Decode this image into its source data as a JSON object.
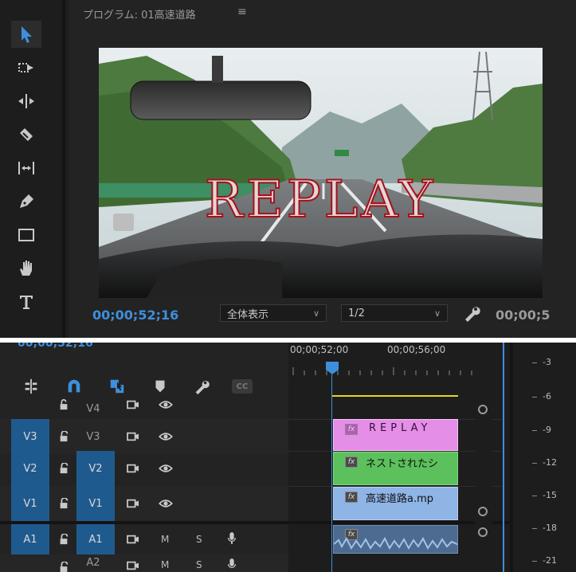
{
  "program_monitor": {
    "title": "プログラム: 01高速道路",
    "menu_icon": "≡",
    "timecode_current": "00;00;52;16",
    "timecode_duration": "00;00;5",
    "fit_dropdown": "全体表示",
    "resolution_dropdown": "1/2",
    "overlay_text": "REPLAY"
  },
  "tools": [
    {
      "name": "selection-tool-icon",
      "active": true
    },
    {
      "name": "track-select-forward-icon"
    },
    {
      "name": "ripple-edit-icon"
    },
    {
      "name": "razor-icon"
    },
    {
      "name": "slip-icon"
    },
    {
      "name": "pen-icon"
    },
    {
      "name": "rectangle-icon"
    },
    {
      "name": "hand-icon"
    },
    {
      "name": "type-icon"
    }
  ],
  "timeline": {
    "timecode": "00;00;52;16",
    "cc_label": "CC",
    "ruler": [
      "00;00;52;00",
      "00;00;56;00"
    ],
    "tracks": [
      {
        "id": "v4",
        "target": "",
        "label": "V4"
      },
      {
        "id": "v3",
        "target": "V3",
        "label": "V3"
      },
      {
        "id": "v2",
        "target": "V2",
        "label": "V2"
      },
      {
        "id": "v1",
        "target": "V1",
        "label": "V1"
      },
      {
        "id": "a1",
        "target": "A1",
        "label": "A1",
        "mute": "M",
        "solo": "S"
      },
      {
        "id": "a2",
        "target": "",
        "label": "A2",
        "mute": "M",
        "solo": "S"
      }
    ],
    "clips": {
      "v3": {
        "name": "REPLAY",
        "color": "#e58ee8"
      },
      "v2": {
        "name": "ネストされたシ",
        "color": "#5cc15c"
      },
      "v1": {
        "name": "高速道路a.mp",
        "color": "#8fb4e6"
      },
      "a1": {
        "color": "#4d6b8f"
      }
    },
    "fx_label": "fx"
  },
  "meter": {
    "labels": [
      "-3",
      "-6",
      "-9",
      "-12",
      "-15",
      "-18",
      "-21"
    ]
  },
  "colors": {
    "accent": "#3d8fdc",
    "work_area": "#e6d22a",
    "target_track": "#1f5a8e"
  }
}
